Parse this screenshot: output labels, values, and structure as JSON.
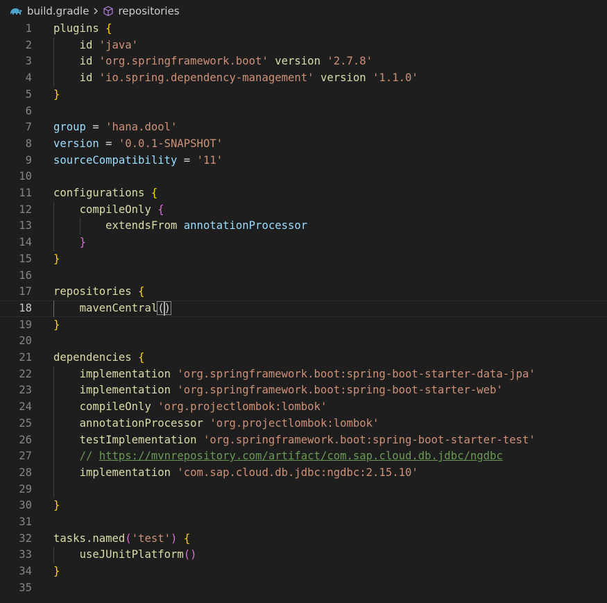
{
  "breadcrumb": {
    "file": "build.gradle",
    "symbol": "repositories",
    "file_icon": "gradle-elephant-icon",
    "symbol_icon": "cube-icon"
  },
  "editor": {
    "current_line": 18,
    "lines": [
      {
        "n": "1",
        "tokens": [
          [
            "k",
            "plugins"
          ],
          [
            "p",
            " "
          ],
          [
            "b1",
            "{"
          ]
        ]
      },
      {
        "n": "2",
        "tokens": [
          [
            "p",
            "    "
          ],
          [
            "k",
            "id"
          ],
          [
            "p",
            " "
          ],
          [
            "s",
            "'java'"
          ]
        ]
      },
      {
        "n": "3",
        "tokens": [
          [
            "p",
            "    "
          ],
          [
            "k",
            "id"
          ],
          [
            "p",
            " "
          ],
          [
            "s",
            "'org.springframework.boot'"
          ],
          [
            "p",
            " "
          ],
          [
            "k",
            "version"
          ],
          [
            "p",
            " "
          ],
          [
            "s",
            "'2.7.8'"
          ]
        ]
      },
      {
        "n": "4",
        "tokens": [
          [
            "p",
            "    "
          ],
          [
            "k",
            "id"
          ],
          [
            "p",
            " "
          ],
          [
            "s",
            "'io.spring.dependency-management'"
          ],
          [
            "p",
            " "
          ],
          [
            "k",
            "version"
          ],
          [
            "p",
            " "
          ],
          [
            "s",
            "'1.1.0'"
          ]
        ]
      },
      {
        "n": "5",
        "tokens": [
          [
            "b1",
            "}"
          ]
        ]
      },
      {
        "n": "6",
        "tokens": []
      },
      {
        "n": "7",
        "tokens": [
          [
            "v",
            "group"
          ],
          [
            "p",
            " = "
          ],
          [
            "s",
            "'hana.dool'"
          ]
        ]
      },
      {
        "n": "8",
        "tokens": [
          [
            "v",
            "version"
          ],
          [
            "p",
            " = "
          ],
          [
            "s",
            "'0.0.1-SNAPSHOT'"
          ]
        ]
      },
      {
        "n": "9",
        "tokens": [
          [
            "v",
            "sourceCompatibility"
          ],
          [
            "p",
            " = "
          ],
          [
            "s",
            "'11'"
          ]
        ]
      },
      {
        "n": "10",
        "tokens": []
      },
      {
        "n": "11",
        "tokens": [
          [
            "k",
            "configurations"
          ],
          [
            "p",
            " "
          ],
          [
            "b1",
            "{"
          ]
        ]
      },
      {
        "n": "12",
        "tokens": [
          [
            "p",
            "    "
          ],
          [
            "k",
            "compileOnly"
          ],
          [
            "p",
            " "
          ],
          [
            "b2",
            "{"
          ]
        ]
      },
      {
        "n": "13",
        "tokens": [
          [
            "p",
            "        "
          ],
          [
            "k",
            "extendsFrom"
          ],
          [
            "p",
            " "
          ],
          [
            "v",
            "annotationProcessor"
          ]
        ]
      },
      {
        "n": "14",
        "tokens": [
          [
            "p",
            "    "
          ],
          [
            "b2",
            "}"
          ]
        ]
      },
      {
        "n": "15",
        "tokens": [
          [
            "b1",
            "}"
          ]
        ]
      },
      {
        "n": "16",
        "tokens": []
      },
      {
        "n": "17",
        "tokens": [
          [
            "k",
            "repositories"
          ],
          [
            "p",
            " "
          ],
          [
            "b1",
            "{"
          ]
        ]
      },
      {
        "n": "18",
        "tokens": [
          [
            "p",
            "    "
          ],
          [
            "k",
            "mavenCentral"
          ],
          [
            "bm",
            "()"
          ]
        ]
      },
      {
        "n": "19",
        "tokens": [
          [
            "b1",
            "}"
          ]
        ]
      },
      {
        "n": "20",
        "tokens": []
      },
      {
        "n": "21",
        "tokens": [
          [
            "k",
            "dependencies"
          ],
          [
            "p",
            " "
          ],
          [
            "b1",
            "{"
          ]
        ]
      },
      {
        "n": "22",
        "tokens": [
          [
            "p",
            "    "
          ],
          [
            "k",
            "implementation"
          ],
          [
            "p",
            " "
          ],
          [
            "s",
            "'org.springframework.boot:spring-boot-starter-data-jpa'"
          ]
        ]
      },
      {
        "n": "23",
        "tokens": [
          [
            "p",
            "    "
          ],
          [
            "k",
            "implementation"
          ],
          [
            "p",
            " "
          ],
          [
            "s",
            "'org.springframework.boot:spring-boot-starter-web'"
          ]
        ]
      },
      {
        "n": "24",
        "tokens": [
          [
            "p",
            "    "
          ],
          [
            "k",
            "compileOnly"
          ],
          [
            "p",
            " "
          ],
          [
            "s",
            "'org.projectlombok:lombok'"
          ]
        ]
      },
      {
        "n": "25",
        "tokens": [
          [
            "p",
            "    "
          ],
          [
            "k",
            "annotationProcessor"
          ],
          [
            "p",
            " "
          ],
          [
            "s",
            "'org.projectlombok:lombok'"
          ]
        ]
      },
      {
        "n": "26",
        "tokens": [
          [
            "p",
            "    "
          ],
          [
            "k",
            "testImplementation"
          ],
          [
            "p",
            " "
          ],
          [
            "s",
            "'org.springframework.boot:spring-boot-starter-test'"
          ]
        ]
      },
      {
        "n": "27",
        "tokens": [
          [
            "p",
            "    "
          ],
          [
            "c",
            "// "
          ],
          [
            "u",
            "https://mvnrepository.com/artifact/com.sap.cloud.db.jdbc/ngdbc"
          ]
        ]
      },
      {
        "n": "28",
        "tokens": [
          [
            "p",
            "    "
          ],
          [
            "k",
            "implementation"
          ],
          [
            "p",
            " "
          ],
          [
            "s",
            "'com.sap.cloud.db.jdbc:ngdbc:2.15.10'"
          ]
        ]
      },
      {
        "n": "29",
        "tokens": []
      },
      {
        "n": "30",
        "tokens": [
          [
            "b1",
            "}"
          ]
        ]
      },
      {
        "n": "31",
        "tokens": []
      },
      {
        "n": "32",
        "tokens": [
          [
            "k",
            "tasks"
          ],
          [
            "p",
            "."
          ],
          [
            "k",
            "named"
          ],
          [
            "b2",
            "("
          ],
          [
            "s",
            "'test'"
          ],
          [
            "b2",
            ")"
          ],
          [
            "p",
            " "
          ],
          [
            "b1",
            "{"
          ]
        ]
      },
      {
        "n": "33",
        "tokens": [
          [
            "p",
            "    "
          ],
          [
            "k",
            "useJUnitPlatform"
          ],
          [
            "b2",
            "()"
          ]
        ]
      },
      {
        "n": "34",
        "tokens": [
          [
            "b1",
            "}"
          ]
        ]
      },
      {
        "n": "35",
        "tokens": []
      }
    ],
    "guides": [
      {
        "from": 2,
        "to": 4,
        "level": 1
      },
      {
        "from": 12,
        "to": 14,
        "level": 1
      },
      {
        "from": 13,
        "to": 13,
        "level": 2
      },
      {
        "from": 18,
        "to": 18,
        "level": 1,
        "active": true
      },
      {
        "from": 22,
        "to": 29,
        "level": 1
      },
      {
        "from": 33,
        "to": 33,
        "level": 1
      }
    ]
  },
  "colors": {
    "background": "#1e1e1e",
    "function": "#dcdcaa",
    "variable": "#9cdcfe",
    "string": "#ce9178",
    "comment": "#6a9955",
    "bracket_level1": "#ffd700",
    "bracket_level2": "#da70d6",
    "line_number": "#858585"
  }
}
